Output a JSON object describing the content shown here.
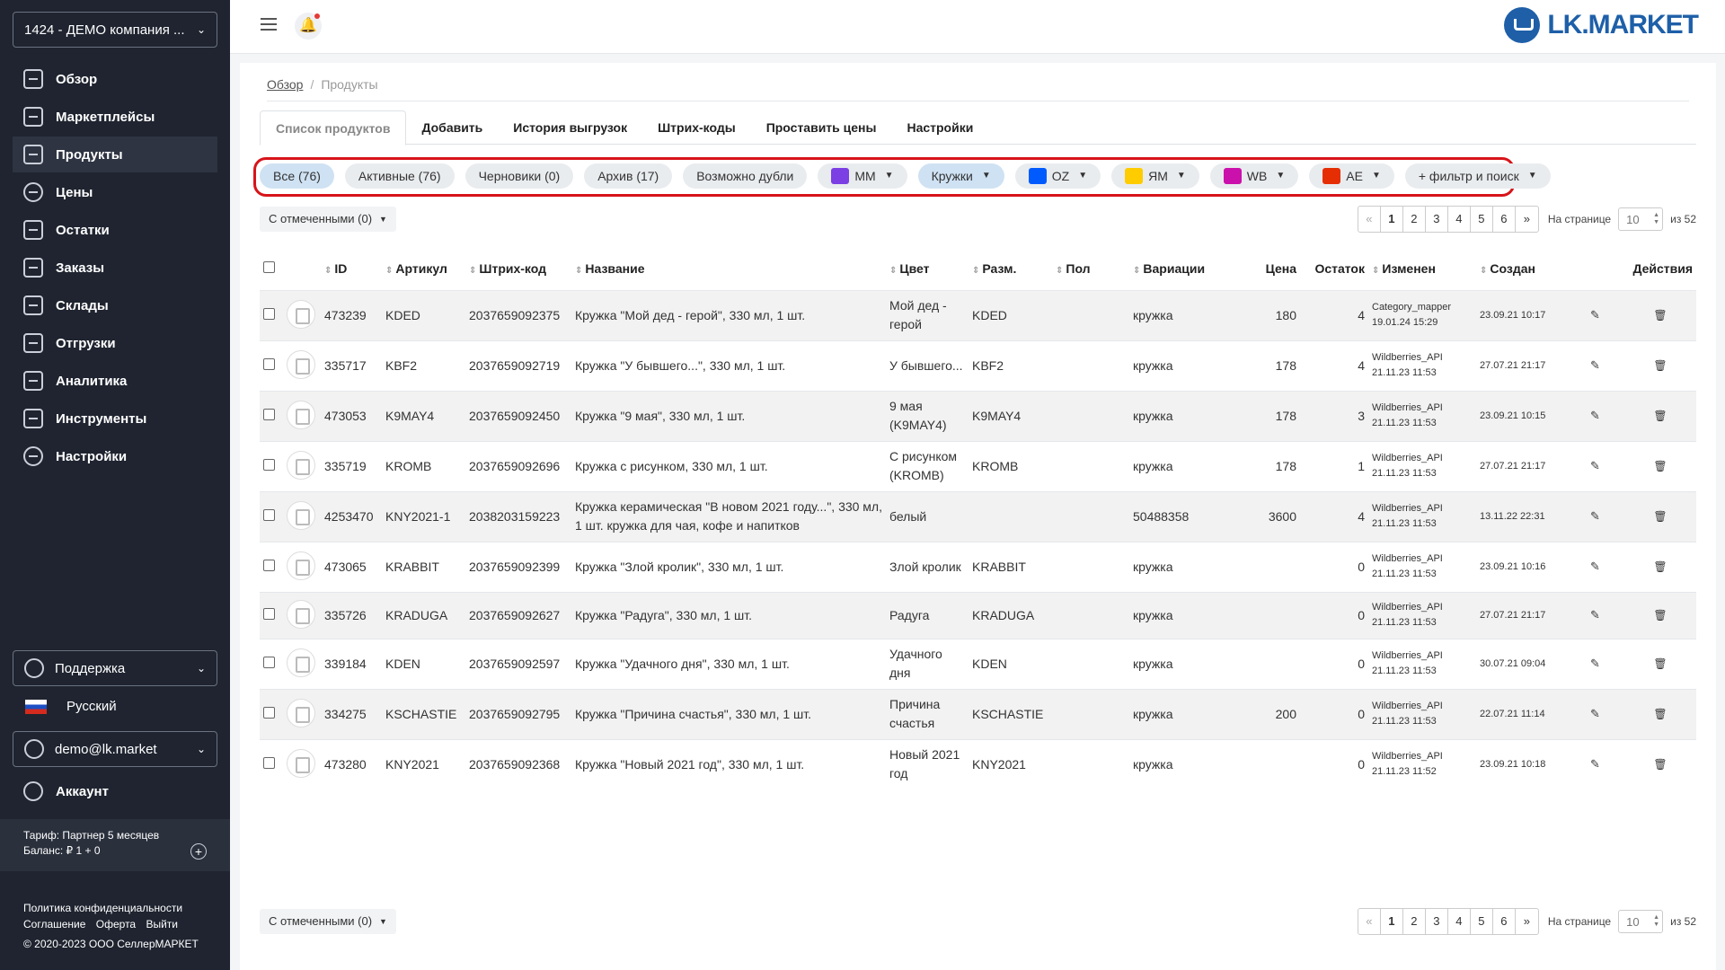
{
  "sidebar": {
    "company": "1424 - ДЕМО компания ...",
    "nav": [
      "Обзор",
      "Маркетплейсы",
      "Продукты",
      "Цены",
      "Остатки",
      "Заказы",
      "Склады",
      "Отгрузки",
      "Аналитика",
      "Инструменты",
      "Настройки"
    ],
    "active_nav": "Продукты",
    "support": "Поддержка",
    "language": "Русский",
    "user": "demo@lk.market",
    "account": "Аккаунт",
    "tariff_line1": "Тариф: Партнер 5 месяцев",
    "tariff_line2": "Баланс: ₽ 1 + 0",
    "plus": "+",
    "footer": {
      "privacy": "Политика конфиденциальности",
      "agreement": "Соглашение",
      "offer": "Оферта",
      "logout": "Выйти",
      "copyright": "© 2020-2023 ООО СеллерМАРКЕТ"
    }
  },
  "topbar": {
    "bell": "🔔",
    "logo": "LK.MARKET"
  },
  "breadcrumb": {
    "home": "Обзор",
    "current": "Продукты"
  },
  "tabs": [
    "Список продуктов",
    "Добавить",
    "История выгрузок",
    "Штрих-коды",
    "Проставить цены",
    "Настройки"
  ],
  "filters": {
    "all": "Все (76)",
    "active": "Активные (76)",
    "drafts": "Черновики (0)",
    "archive": "Архив (17)",
    "dupes": "Возможно дубли",
    "mm": "MM",
    "category": "Кружки",
    "oz": "OZ",
    "ym": "ЯМ",
    "wb": "WB",
    "ae": "AE",
    "more": "+ фильтр и поиск",
    "colors": {
      "mm": "#7b3fe4",
      "oz": "#005bff",
      "ym": "#ffcc00",
      "wb": "#cb11ab",
      "ae": "#e62e04"
    }
  },
  "selected": "С отмеченными (0)",
  "pager": {
    "prev": "«",
    "pages": [
      "1",
      "2",
      "3",
      "4",
      "5",
      "6"
    ],
    "next": "»",
    "per_page_label": "На странице",
    "per_page": "10",
    "of": "из 52"
  },
  "table": {
    "headers": {
      "id": "ID",
      "article": "Артикул",
      "barcode": "Штрих-код",
      "name": "Название",
      "color": "Цвет",
      "size": "Разм.",
      "gender": "Пол",
      "variations": "Вариации",
      "price": "Цена",
      "stock": "Остаток",
      "modified": "Изменен",
      "created": "Создан",
      "actions": "Действия"
    },
    "rows": [
      {
        "id": "473239",
        "article": "KDED",
        "barcode": "2037659092375",
        "name": "Кружка \"Мой дед - герой\", 330 мл, 1 шт.",
        "color": "Мой дед - герой",
        "size": "KDED",
        "variation": "кружка",
        "price": "180",
        "stock": "4",
        "mod_by": "Category_mapper",
        "mod_at": "19.01.24 15:29",
        "created": "23.09.21 10:17"
      },
      {
        "id": "335717",
        "article": "KBF2",
        "barcode": "2037659092719",
        "name": "Кружка \"У бывшего...\", 330 мл, 1 шт.",
        "color": "У бывшего...",
        "size": "KBF2",
        "variation": "кружка",
        "price": "178",
        "stock": "4",
        "mod_by": "Wildberries_API",
        "mod_at": "21.11.23 11:53",
        "created": "27.07.21 21:17"
      },
      {
        "id": "473053",
        "article": "K9MAY4",
        "barcode": "2037659092450",
        "name": "Кружка \"9 мая\", 330 мл, 1 шт.",
        "color": "9 мая (K9MAY4)",
        "size": "K9MAY4",
        "variation": "кружка",
        "price": "178",
        "stock": "3",
        "mod_by": "Wildberries_API",
        "mod_at": "21.11.23 11:53",
        "created": "23.09.21 10:15"
      },
      {
        "id": "335719",
        "article": "KROMB",
        "barcode": "2037659092696",
        "name": "Кружка с рисунком, 330 мл, 1 шт.",
        "color": "С рисунком (KROMB)",
        "size": "KROMB",
        "variation": "кружка",
        "price": "178",
        "stock": "1",
        "mod_by": "Wildberries_API",
        "mod_at": "21.11.23 11:53",
        "created": "27.07.21 21:17"
      },
      {
        "id": "4253470",
        "article": "KNY2021-1",
        "barcode": "2038203159223",
        "name": "Кружка керамическая \"В новом 2021 году...\", 330 мл, 1 шт. кружка для чая, кофе и напитков",
        "color": "белый",
        "size": "",
        "variation": "50488358",
        "price": "3600",
        "stock": "4",
        "mod_by": "Wildberries_API",
        "mod_at": "21.11.23 11:53",
        "created": "13.11.22 22:31"
      },
      {
        "id": "473065",
        "article": "KRABBIT",
        "barcode": "2037659092399",
        "name": "Кружка \"Злой кролик\", 330 мл, 1 шт.",
        "color": "Злой кролик",
        "size": "KRABBIT",
        "variation": "кружка",
        "price": "",
        "stock": "0",
        "mod_by": "Wildberries_API",
        "mod_at": "21.11.23 11:53",
        "created": "23.09.21 10:16"
      },
      {
        "id": "335726",
        "article": "KRADUGA",
        "barcode": "2037659092627",
        "name": "Кружка \"Радуга\", 330 мл, 1 шт.",
        "color": "Радуга",
        "size": "KRADUGA",
        "variation": "кружка",
        "price": "",
        "stock": "0",
        "mod_by": "Wildberries_API",
        "mod_at": "21.11.23 11:53",
        "created": "27.07.21 21:17"
      },
      {
        "id": "339184",
        "article": "KDEN",
        "barcode": "2037659092597",
        "name": "Кружка \"Удачного дня\", 330 мл, 1 шт.",
        "color": "Удачного дня",
        "size": "KDEN",
        "variation": "кружка",
        "price": "",
        "stock": "0",
        "mod_by": "Wildberries_API",
        "mod_at": "21.11.23 11:53",
        "created": "30.07.21 09:04"
      },
      {
        "id": "334275",
        "article": "KSCHASTIE",
        "barcode": "2037659092795",
        "name": "Кружка \"Причина счастья\", 330 мл, 1 шт.",
        "color": "Причина счастья",
        "size": "KSCHASTIE",
        "variation": "кружка",
        "price": "200",
        "stock": "0",
        "mod_by": "Wildberries_API",
        "mod_at": "21.11.23 11:53",
        "created": "22.07.21 11:14"
      },
      {
        "id": "473280",
        "article": "KNY2021",
        "barcode": "2037659092368",
        "name": "Кружка \"Новый 2021 год\", 330 мл, 1 шт.",
        "color": "Новый 2021 год",
        "size": "KNY2021",
        "variation": "кружка",
        "price": "",
        "stock": "0",
        "mod_by": "Wildberries_API",
        "mod_at": "21.11.23 11:52",
        "created": "23.09.21 10:18"
      }
    ],
    "edit_icon": "✎",
    "delete_icon": "🗑"
  }
}
